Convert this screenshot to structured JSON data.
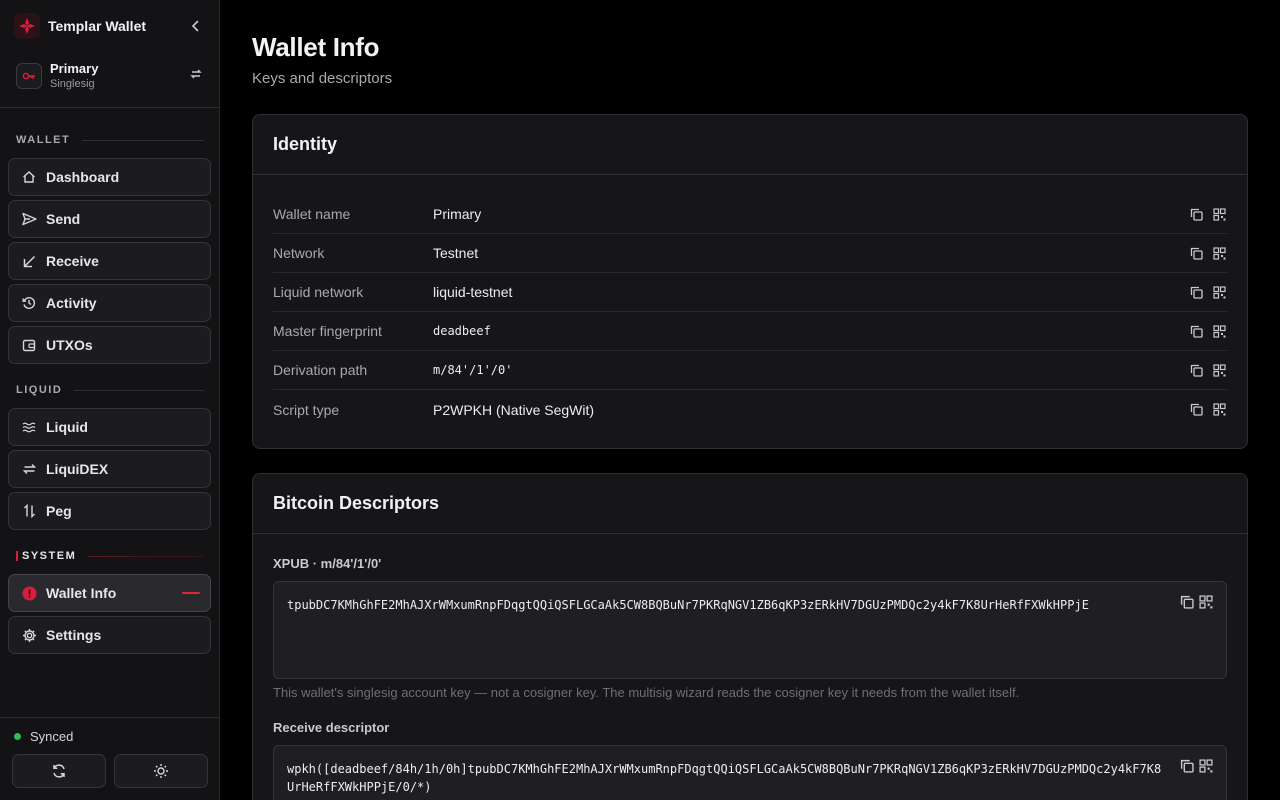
{
  "app": {
    "title": "Templar Wallet"
  },
  "wallet": {
    "name": "Primary",
    "type": "Singlesig"
  },
  "sidebar": {
    "sections": [
      {
        "label": "WALLET"
      },
      {
        "label": "LIQUID"
      },
      {
        "label": "SYSTEM"
      }
    ],
    "items": [
      {
        "label": "Dashboard",
        "icon": "home-icon"
      },
      {
        "label": "Send",
        "icon": "send-icon"
      },
      {
        "label": "Receive",
        "icon": "receive-arrow-icon"
      },
      {
        "label": "Activity",
        "icon": "history-icon"
      },
      {
        "label": "UTXOs",
        "icon": "wallet-icon"
      },
      {
        "label": "Liquid",
        "icon": "waves-icon"
      },
      {
        "label": "LiquiDEX",
        "icon": "swap-icon"
      },
      {
        "label": "Peg",
        "icon": "peg-arrows-icon"
      },
      {
        "label": "Wallet Info",
        "icon": "info-dot-icon",
        "active": true
      },
      {
        "label": "Settings",
        "icon": "gear-icon"
      }
    ],
    "status": "Synced"
  },
  "page": {
    "title": "Wallet Info",
    "subtitle": "Keys and descriptors"
  },
  "identity": {
    "title": "Identity",
    "rows": [
      {
        "label": "Wallet name",
        "value": "Primary"
      },
      {
        "label": "Network",
        "value": "Testnet"
      },
      {
        "label": "Liquid network",
        "value": "liquid-testnet"
      },
      {
        "label": "Master fingerprint",
        "value": "deadbeef"
      },
      {
        "label": "Derivation path",
        "value": "m/84'/1'/0'"
      },
      {
        "label": "Script type",
        "value": "P2WPKH (Native SegWit)"
      }
    ]
  },
  "descriptors": {
    "title": "Bitcoin Descriptors",
    "xpub_label": "XPUB · m/84'/1'/0'",
    "xpub": "tpubDC7KMhGhFE2MhAJXrWMxumRnpFDqgtQQiQSFLGCaAk5CW8BQBuNr7PKRqNGV1ZB6qKP3zERkHV7DGUzPMDQc2y4kF7K8UrHeRfFXWkHPPjE",
    "xpub_help": "This wallet's singlesig account key — not a cosigner key. The multisig wizard reads the cosigner key it needs from the wallet itself.",
    "receive_label": "Receive descriptor",
    "receive": "wpkh([deadbeef/84h/1h/0h]tpubDC7KMhGhFE2MhAJXrWMxumRnpFDqgtQQiQSFLGCaAk5CW8BQBuNr7PKRqNGV1ZB6qKP3zERkHV7DGUzPMDQc2y4kF7K8UrHeRfFXWkHPPjE/0/*)"
  },
  "colors": {
    "accent": "#e0263f",
    "synced": "#2fbf5a",
    "background": "#000000",
    "card": "#161618"
  }
}
